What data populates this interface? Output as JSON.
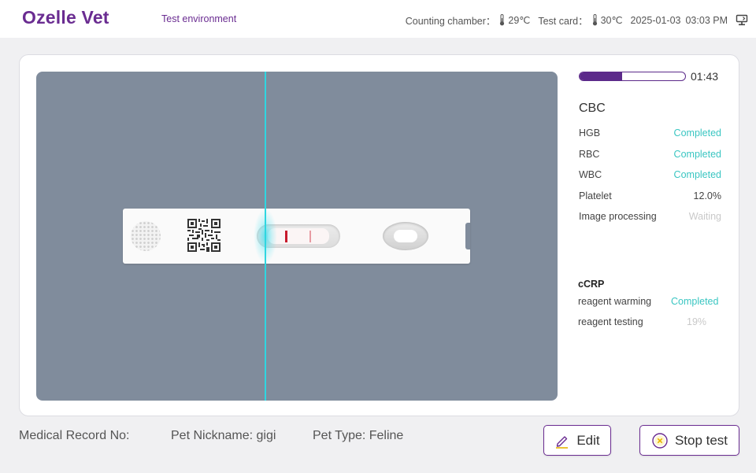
{
  "header": {
    "brand": "Ozelle Vet",
    "environment": "Test environment",
    "counting_chamber_label": "Counting chamber：",
    "counting_chamber_temp": "29℃",
    "test_card_label": "Test card：",
    "test_card_temp": "30℃",
    "date": "2025-01-03",
    "time": "03:03 PM",
    "icons": [
      "thermometer-icon",
      "thermometer-icon",
      "connection-icon"
    ]
  },
  "colors": {
    "brand": "#6a2c91",
    "completed": "#3ac6c2",
    "waiting": "#c9c9c9",
    "scan_line": "#2fd6e0",
    "viewer_bg": "#808c9c"
  },
  "progress": {
    "fraction": 0.4,
    "remaining": "01:43"
  },
  "cbc": {
    "title": "CBC",
    "items": [
      {
        "name": "HGB",
        "status": "Completed",
        "state": "completed"
      },
      {
        "name": "RBC",
        "status": "Completed",
        "state": "completed"
      },
      {
        "name": "WBC",
        "status": "Completed",
        "state": "completed"
      },
      {
        "name": "Platelet",
        "status": "12.0%",
        "state": "active"
      },
      {
        "name": "Image processing",
        "status": "Waiting",
        "state": "waiting"
      }
    ]
  },
  "ccrp": {
    "title": "cCRP",
    "items": [
      {
        "name": "reagent warming",
        "status": "Completed",
        "state": "completed"
      },
      {
        "name": "reagent testing",
        "status": "19%",
        "state": "waiting"
      }
    ]
  },
  "footer": {
    "record_label": "Medical Record No:",
    "pet_nickname": "Pet Nickname: gigi",
    "pet_type": "Pet Type: Feline",
    "edit_label": "Edit",
    "stop_label": "Stop test",
    "icons": [
      "edit-pencil-icon",
      "stop-circle-icon"
    ]
  }
}
